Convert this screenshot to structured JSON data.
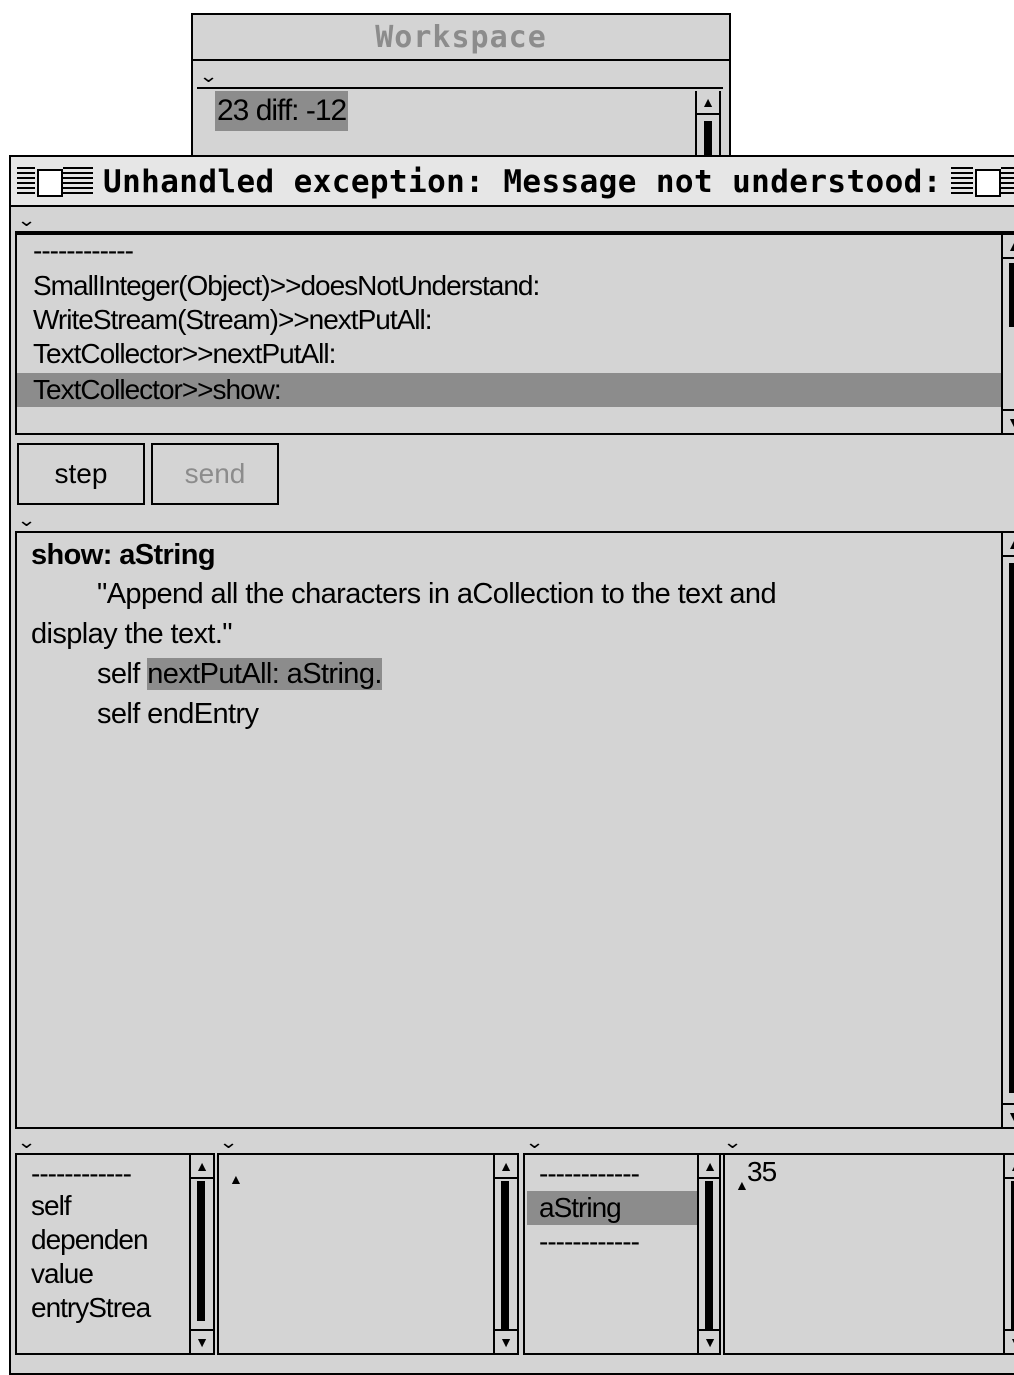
{
  "workspace": {
    "title": "Workspace",
    "text": "23 diff: -12"
  },
  "debugger": {
    "title": "Unhandled exception: Message not understood:",
    "stack": [
      "------------",
      "SmallInteger(Object)>>doesNotUnderstand:",
      "WriteStream(Stream)>>nextPutAll:",
      "TextCollector>>nextPutAll:",
      "TextCollector>>show:"
    ],
    "selected_stack_index": 4,
    "buttons": {
      "step": "step",
      "send": "send"
    },
    "code": {
      "line1": "show: aString",
      "line2": "\"Append all the characters in aCollection to the text and",
      "line3": "display the text.\"",
      "line4_pre": "self ",
      "line4_sel": "nextPutAll: aString.",
      "line5": "self endEntry"
    },
    "receiver_vars": [
      "------------",
      "self",
      "dependen",
      "value",
      "entryStrea"
    ],
    "receiver_value": "",
    "context_vars": [
      "------------",
      "aString",
      "------------"
    ],
    "context_value": "35"
  }
}
